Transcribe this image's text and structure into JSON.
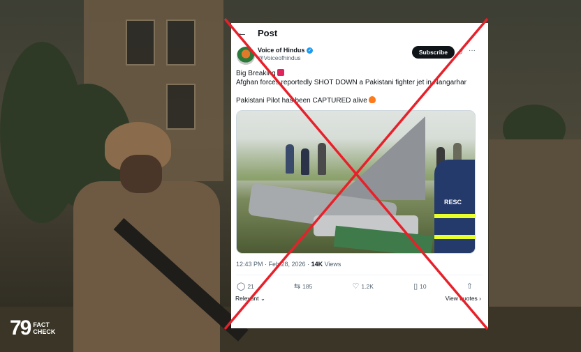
{
  "post": {
    "header_title": "Post",
    "back_icon": "arrow-left-icon",
    "author_name": "Voice of Hindus",
    "author_handle": "@Voiceofhindus",
    "subscribe_label": "Subscribe",
    "text_line1": "Big Breaking",
    "text_line2": "Afghan forces reportedly SHOT DOWN a Pakistani fighter jet in Nangarhar",
    "text_line3": "Pakistani Pilot has been CAPTURED alive",
    "timestamp": "12:43 PM · Feb 28, 2026 · ",
    "views_count": "14K",
    "views_label": " Views",
    "replies": "21",
    "reposts": "185",
    "likes": "1.2K",
    "bookmarks": "10",
    "sort_label": "Relevant",
    "view_quotes_label": "View quotes",
    "media_text": "RESC"
  },
  "overlay": {
    "cross_color": "#e8202a",
    "logo_number": "79",
    "logo_word1": "FACT",
    "logo_word2": "CHECK"
  },
  "colors": {
    "x_black": "#0f1419",
    "muted": "#536471",
    "verified_blue": "#1d9bf0"
  }
}
